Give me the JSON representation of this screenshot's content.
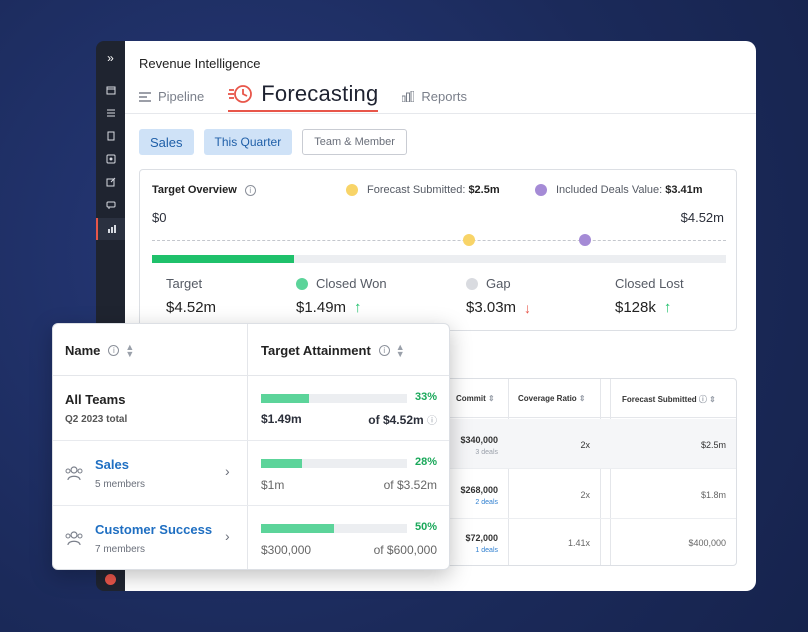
{
  "app": {
    "title": "Revenue Intelligence"
  },
  "tabs": [
    {
      "label": "Pipeline",
      "icon": "list-icon"
    },
    {
      "label": "Forecasting",
      "icon": "clock-icon",
      "active": true
    },
    {
      "label": "Reports",
      "icon": "bar-chart-icon"
    }
  ],
  "filters": {
    "sales": "Sales",
    "quarter": "This Quarter",
    "team_member": "Team & Member"
  },
  "overview": {
    "title": "Target Overview",
    "legend_submitted_label": "Forecast Submitted:",
    "legend_submitted_value": "$2.5m",
    "legend_included_label": "Included Deals Value:",
    "legend_included_value": "$3.41m",
    "min": "$0",
    "max": "$4.52m",
    "submitted_fraction": 0.553,
    "included_fraction": 0.754,
    "closed_won_fraction": 0.33,
    "colors": {
      "submitted": "#f8d468",
      "included": "#a58bd6",
      "won": "#1fc16b",
      "gap": "#d9dbe0"
    },
    "stats": [
      {
        "label": "Target",
        "value": "$4.52m"
      },
      {
        "label": "Closed Won",
        "value": "$1.49m",
        "trend": "up"
      },
      {
        "label": "Gap",
        "value": "$3.03m",
        "trend": "down"
      },
      {
        "label": "Closed Lost",
        "value": "$128k",
        "trend": "up"
      }
    ]
  },
  "bg_table": {
    "headers": {
      "commit": "Commit",
      "coverage": "Coverage Ratio",
      "submitted": "Forecast Submitted"
    },
    "rows": [
      {
        "commit": "$340,000",
        "deals": "3 deals",
        "coverage": "2x",
        "submitted": "$2.5m"
      },
      {
        "commit": "$268,000",
        "deals": "2 deals",
        "coverage": "2x",
        "submitted": "$1.8m"
      },
      {
        "commit": "$72,000",
        "deals": "1 deals",
        "coverage": "1.41x",
        "submitted": "$400,000"
      }
    ]
  },
  "overlay": {
    "header_name": "Name",
    "header_attainment": "Target Attainment",
    "rows": [
      {
        "name": "All Teams",
        "sub": "Q2 2023 total",
        "pct": "33%",
        "fraction": 0.33,
        "closed": "$1.49m",
        "target": "of $4.52m"
      },
      {
        "name": "Sales",
        "sub": "5 members",
        "pct": "28%",
        "fraction": 0.28,
        "closed": "$1m",
        "target": "of $3.52m"
      },
      {
        "name": "Customer Success",
        "sub": "7 members",
        "pct": "50%",
        "fraction": 0.5,
        "closed": "$300,000",
        "target": "of $600,000"
      }
    ]
  }
}
